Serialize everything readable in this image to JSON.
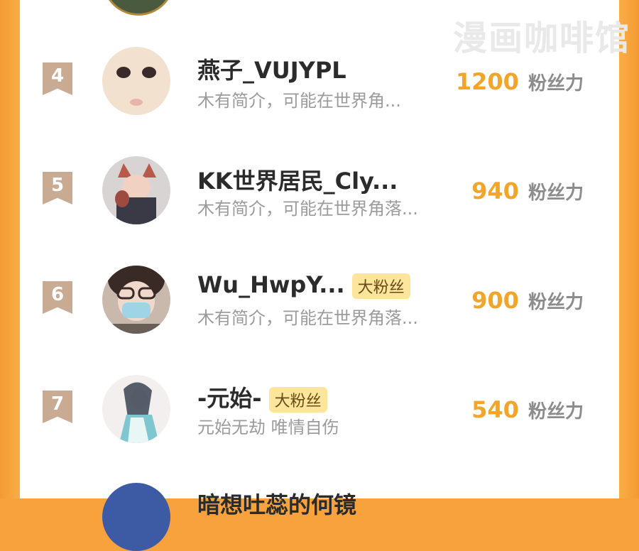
{
  "watermark": "漫画咖啡馆",
  "rows": [
    {
      "rank": "4",
      "name": "燕子_VUJYPL",
      "badge": "",
      "bio": "木有简介，可能在世界角...",
      "value": "1200",
      "unit": "粉丝力"
    },
    {
      "rank": "5",
      "name": "KK世界居民_Cly...",
      "badge": "",
      "bio": "木有简介，可能在世界角落...",
      "value": "940",
      "unit": "粉丝力"
    },
    {
      "rank": "6",
      "name": "Wu_HwpY...",
      "badge": "大粉丝",
      "bio": "木有简介，可能在世界角落...",
      "value": "900",
      "unit": "粉丝力"
    },
    {
      "rank": "7",
      "name": "-元始-",
      "badge": "大粉丝",
      "bio": "元始无劫 唯情自伤",
      "value": "540",
      "unit": "粉丝力"
    }
  ],
  "next_row": {
    "name": "暗想吐蕊的何镜"
  },
  "colors": {
    "accent": "#f2a529",
    "rank_bg": "#c9ab93",
    "badge_bg": "#fde59c",
    "frame": "#f7a23c"
  }
}
